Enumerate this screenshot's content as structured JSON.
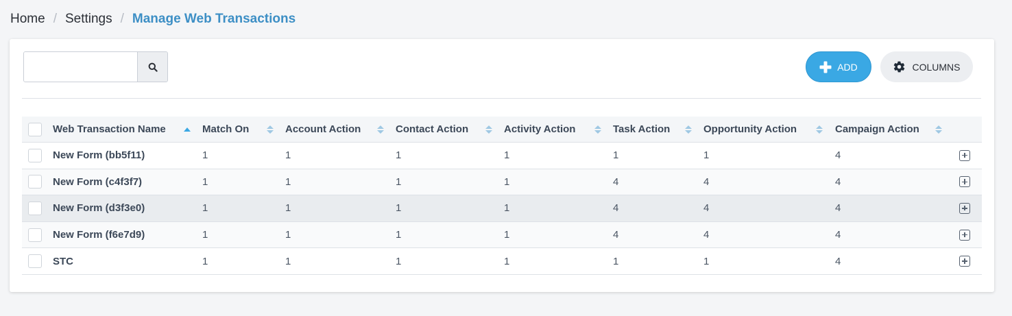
{
  "breadcrumb": {
    "home": "Home",
    "settings": "Settings",
    "current": "Manage Web Transactions",
    "separator": "/"
  },
  "toolbar": {
    "search": {
      "value": "",
      "placeholder": ""
    },
    "add_label": "ADD",
    "columns_label": "COLUMNS"
  },
  "colors": {
    "accent": "#3aa8e4",
    "breadcrumb_active": "#3d8fc5",
    "sort_active": "#3aa8e4",
    "sort_inactive": "#9fc8e3"
  },
  "table": {
    "columns": [
      {
        "label": "Web Transaction Name",
        "sort": "asc"
      },
      {
        "label": "Match On",
        "sort": "none"
      },
      {
        "label": "Account Action",
        "sort": "none"
      },
      {
        "label": "Contact Action",
        "sort": "none"
      },
      {
        "label": "Activity Action",
        "sort": "none"
      },
      {
        "label": "Task Action",
        "sort": "none"
      },
      {
        "label": "Opportunity Action",
        "sort": "none"
      },
      {
        "label": "Campaign Action",
        "sort": "none"
      }
    ],
    "rows": [
      {
        "cells": [
          "New Form (bb5f11)",
          "1",
          "1",
          "1",
          "1",
          "1",
          "1",
          "4"
        ]
      },
      {
        "cells": [
          "New Form (c4f3f7)",
          "1",
          "1",
          "1",
          "1",
          "4",
          "4",
          "4"
        ]
      },
      {
        "cells": [
          "New Form (d3f3e0)",
          "1",
          "1",
          "1",
          "1",
          "4",
          "4",
          "4"
        ]
      },
      {
        "cells": [
          "New Form (f6e7d9)",
          "1",
          "1",
          "1",
          "1",
          "4",
          "4",
          "4"
        ]
      },
      {
        "cells": [
          "STC",
          "1",
          "1",
          "1",
          "1",
          "1",
          "1",
          "4"
        ]
      }
    ]
  }
}
